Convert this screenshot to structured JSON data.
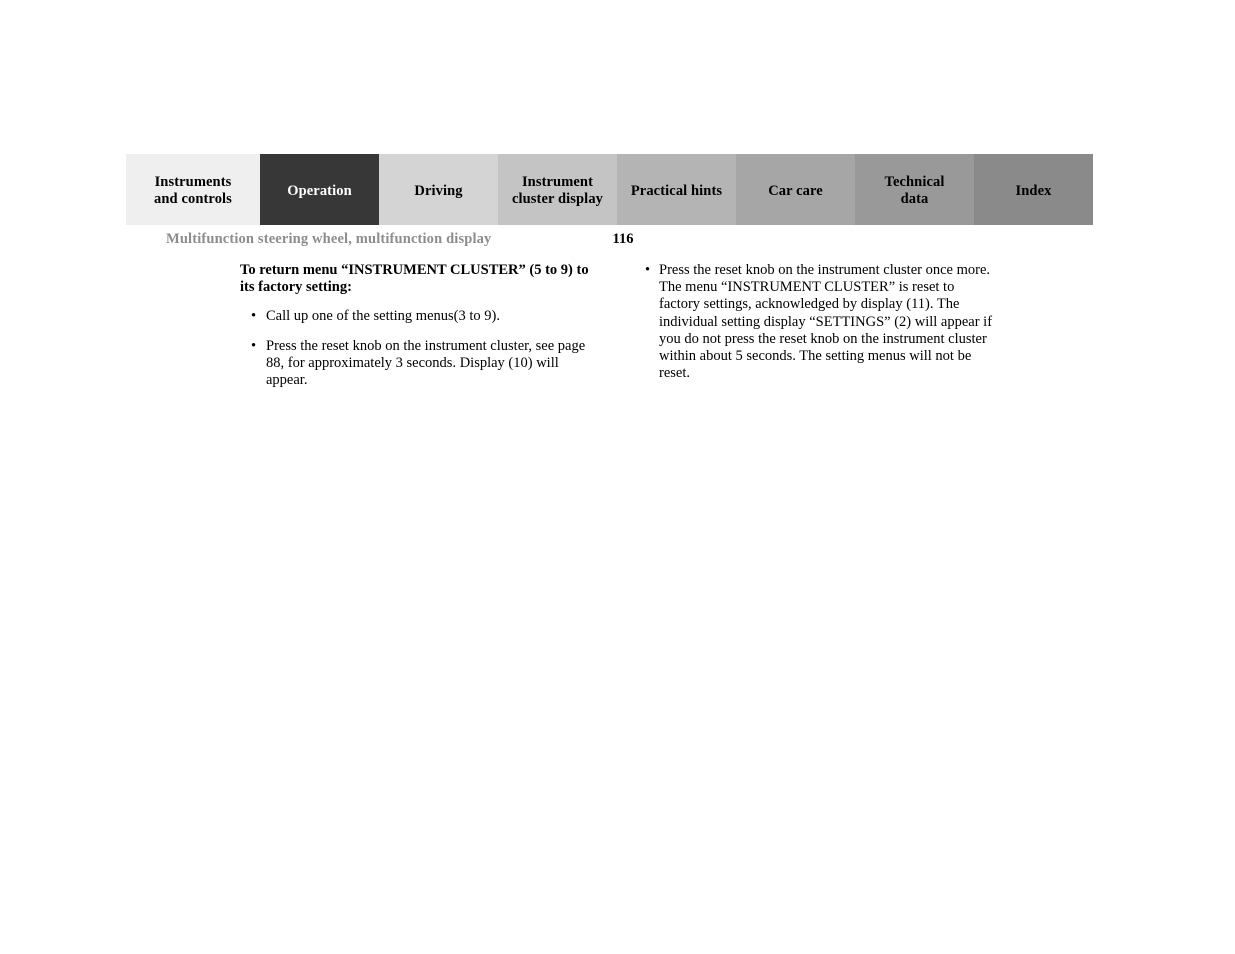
{
  "tabs": [
    {
      "lines": [
        "Instruments",
        "and controls"
      ],
      "bg": "#efefef",
      "active": false,
      "name": "tab-instruments-and-controls"
    },
    {
      "lines": [
        "Operation"
      ],
      "bg": "#373737",
      "active": true,
      "name": "tab-operation"
    },
    {
      "lines": [
        "Driving"
      ],
      "bg": "#d4d4d4",
      "active": false,
      "name": "tab-driving"
    },
    {
      "lines": [
        "Instrument",
        "cluster display"
      ],
      "bg": "#c4c4c4",
      "active": false,
      "name": "tab-instrument-cluster-display"
    },
    {
      "lines": [
        "Practical hints"
      ],
      "bg": "#b4b4b4",
      "active": false,
      "name": "tab-practical-hints"
    },
    {
      "lines": [
        "Car care"
      ],
      "bg": "#a6a6a6",
      "active": false,
      "name": "tab-car-care"
    },
    {
      "lines": [
        "Technical",
        "data"
      ],
      "bg": "#999999",
      "active": false,
      "name": "tab-technical-data"
    },
    {
      "lines": [
        "Index"
      ],
      "bg": "#8a8a8a",
      "active": false,
      "name": "tab-index"
    }
  ],
  "header": {
    "title": "Multifunction steering wheel, multifunction display",
    "page_number": "116",
    "title_color": "#8d8d8d"
  },
  "content": {
    "left_column": {
      "heading": "To return menu “INSTRUMENT CLUSTER” (5 to 9) to its factory setting:",
      "bullet_marker": "•",
      "bullets": [
        "Call up one of the setting menus(3 to 9).",
        "Press the reset knob on the instrument cluster, see page 88, for approximately 3 seconds. Display (10) will appear."
      ]
    },
    "right_column": {
      "bullet_marker": "•",
      "bullets": [
        "Press the reset knob on the instrument cluster once more. The menu “INSTRUMENT CLUSTER” is reset to factory settings, acknowledged by display (11). The individual setting display “SETTINGS” (2) will appear if you do not press the reset knob on the instrument cluster within about 5 seconds. The setting menus will not be reset."
      ]
    }
  }
}
